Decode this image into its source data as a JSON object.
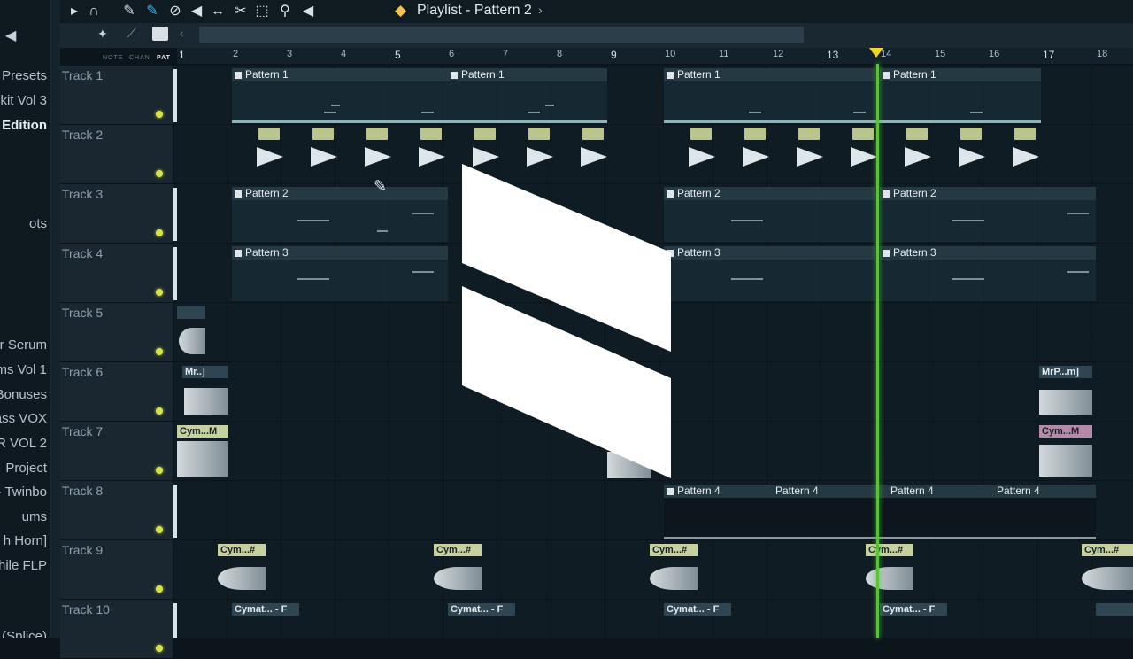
{
  "browser": {
    "items": [
      " Presets",
      "kit Vol 3",
      "Edition",
      "ots",
      "r Serum",
      "ms Vol 1",
      "Bonuses",
      "Bass VOX",
      "R VOL 2",
      " Project",
      "- Twinbo",
      "ums",
      "h Horn]",
      "While FLP",
      "(Splice)"
    ]
  },
  "toolbar": {
    "title": "Playlist - Pattern 2",
    "title_arrow": "›",
    "tools": [
      "play-icon",
      "magnet-icon",
      "pencil-icon",
      "paint-icon",
      "delete-icon",
      "mute-icon",
      "slip-icon",
      "slice-icon",
      "select-icon",
      "zoom-icon",
      "playback-icon"
    ]
  },
  "subbar": {
    "modes": [
      "NOTE",
      "CHAN",
      "PAT"
    ],
    "scroll_left": "‹"
  },
  "ruler": {
    "bars": [
      "1",
      "2",
      "3",
      "4",
      "5",
      "6",
      "7",
      "8",
      "9",
      "10",
      "11",
      "12",
      "13",
      "14",
      "15",
      "16",
      "17",
      "18"
    ]
  },
  "tracks": [
    {
      "name": "Track 1"
    },
    {
      "name": "Track 2"
    },
    {
      "name": "Track 3"
    },
    {
      "name": "Track 4"
    },
    {
      "name": "Track 5"
    },
    {
      "name": "Track 6"
    },
    {
      "name": "Track 7"
    },
    {
      "name": "Track 8"
    },
    {
      "name": "Track 9"
    },
    {
      "name": "Track 10"
    }
  ],
  "clips": {
    "pattern1": "Pattern 1",
    "pattern2": "Pattern 2",
    "pattern3": "Pattern 3",
    "pattern4": "Pattern 4",
    "mr": "Mr..]",
    "mrp": "MrP...m]",
    "cym_m": "Cym...M",
    "cym_hash": "Cym...#",
    "cymat_f": "Cymat... - F"
  },
  "colors": {
    "playhead": "#56c33a",
    "marker": "#f4d32c",
    "audio_tab": "#c7d1a0"
  }
}
